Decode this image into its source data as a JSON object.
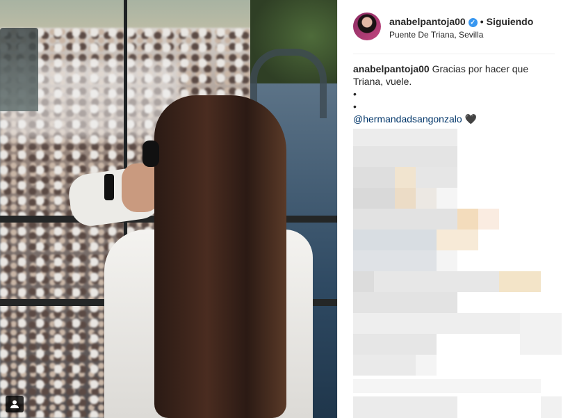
{
  "post": {
    "username": "anabelpantoja00",
    "verified": true,
    "separator": "•",
    "follow_status": "Siguiendo",
    "location": "Puente De Triana, Sevilla"
  },
  "caption": {
    "user": "anabelpantoja00",
    "text": "Gracias por hacer que Triana, vuele.",
    "bullet1": "•",
    "bullet2": "•",
    "mention": "@hermandadsangonzalo",
    "emoji": "🖤"
  },
  "icons": {
    "tag": "user-tag-icon",
    "verified": "verified-badge-icon"
  },
  "colors": {
    "verified_blue": "#3897f0",
    "mention_blue": "#003569"
  }
}
